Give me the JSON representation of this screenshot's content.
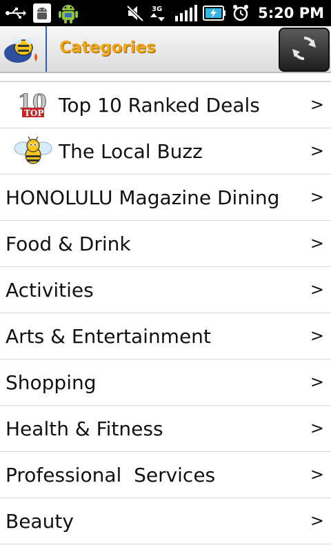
{
  "status_bar": {
    "time": "5:20 PM",
    "network_label": "3G",
    "icons": [
      "usb-icon",
      "android-debug-icon",
      "android-robot-icon",
      "mute-icon",
      "3g-data-icon",
      "signal-icon",
      "battery-charging-icon",
      "alarm-icon"
    ]
  },
  "header": {
    "title": "Categories",
    "logo_icon": "bee-logo-icon",
    "refresh_icon": "refresh-icon"
  },
  "categories": [
    {
      "label": "Top 10 Ranked Deals",
      "icon": "top-10-icon",
      "chevron": ">"
    },
    {
      "label": "The Local Buzz",
      "icon": "bee-icon",
      "chevron": ">"
    },
    {
      "label": "HONOLULU Magazine Dining",
      "chevron": ">"
    },
    {
      "label": "Food & Drink",
      "chevron": ">"
    },
    {
      "label": "Activities",
      "chevron": ">"
    },
    {
      "label": "Arts & Entertainment",
      "chevron": ">"
    },
    {
      "label": "Shopping",
      "chevron": ">"
    },
    {
      "label": "Health & Fitness",
      "chevron": ">"
    },
    {
      "label": "Professional  Services",
      "chevron": ">"
    },
    {
      "label": "Beauty",
      "chevron": ">"
    }
  ],
  "colors": {
    "title_color": "#f2a516",
    "divider": "#d8d8d8"
  }
}
